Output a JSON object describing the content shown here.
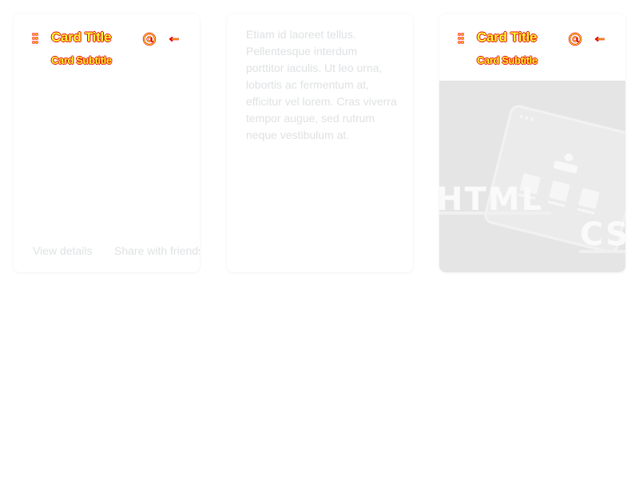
{
  "cards": [
    {
      "title": "Card Title",
      "subtitle": "Card Subtitle",
      "icons": [
        "drag-handle-icon",
        "at-sign-icon",
        "arrow-left-icon"
      ],
      "actions": [
        "View details",
        "Share with friends"
      ]
    },
    {
      "body": "Etiam id laoreet tellus. Pellentesque interdum porttitor iaculis. Ut leo urna, lobortis ac fermentum at, efficitur vel lorem. Cras viverra tempor augue, sed rutrum neque vestibulum at."
    },
    {
      "title": "Card Title",
      "subtitle": "Card Subtitle",
      "icons": [
        "drag-handle-icon",
        "at-sign-icon",
        "arrow-left-icon"
      ],
      "media": {
        "text_html": "HTML",
        "text_css": "CSS"
      }
    }
  ],
  "colors": {
    "page_background": "#ffffff",
    "muted_text": "#dfe1e3",
    "media_background": "#e5e5e5",
    "header_fill": "#ffff33",
    "header_outline": "#e00000"
  }
}
